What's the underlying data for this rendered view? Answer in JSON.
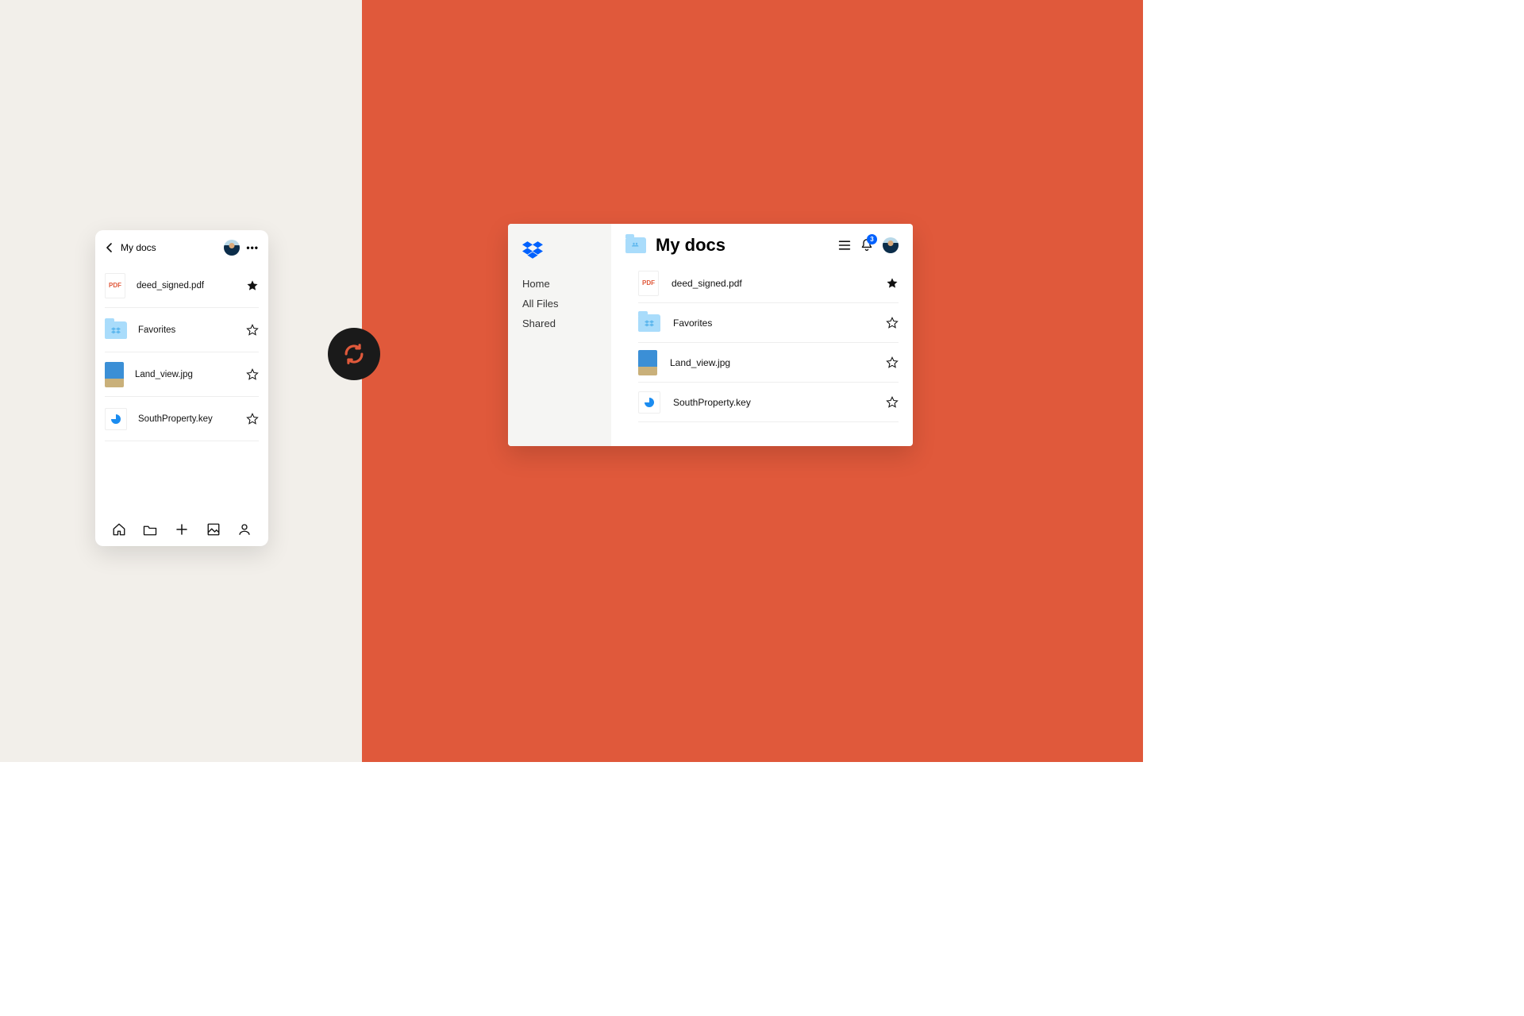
{
  "mobile": {
    "title": "My docs",
    "files": [
      {
        "name": "deed_signed.pdf",
        "type": "pdf",
        "starred": true
      },
      {
        "name": "Favorites",
        "type": "folder",
        "starred": false
      },
      {
        "name": "Land_view.jpg",
        "type": "image",
        "starred": false
      },
      {
        "name": "SouthProperty.key",
        "type": "key",
        "starred": false
      }
    ],
    "pdf_label": "PDF"
  },
  "desktop": {
    "title": "My docs",
    "nav": [
      "Home",
      "All Files",
      "Shared"
    ],
    "notification_count": "3",
    "files": [
      {
        "name": "deed_signed.pdf",
        "type": "pdf",
        "starred": true
      },
      {
        "name": "Favorites",
        "type": "folder",
        "starred": false
      },
      {
        "name": "Land_view.jpg",
        "type": "image",
        "starred": false
      },
      {
        "name": "SouthProperty.key",
        "type": "key",
        "starred": false
      }
    ]
  }
}
